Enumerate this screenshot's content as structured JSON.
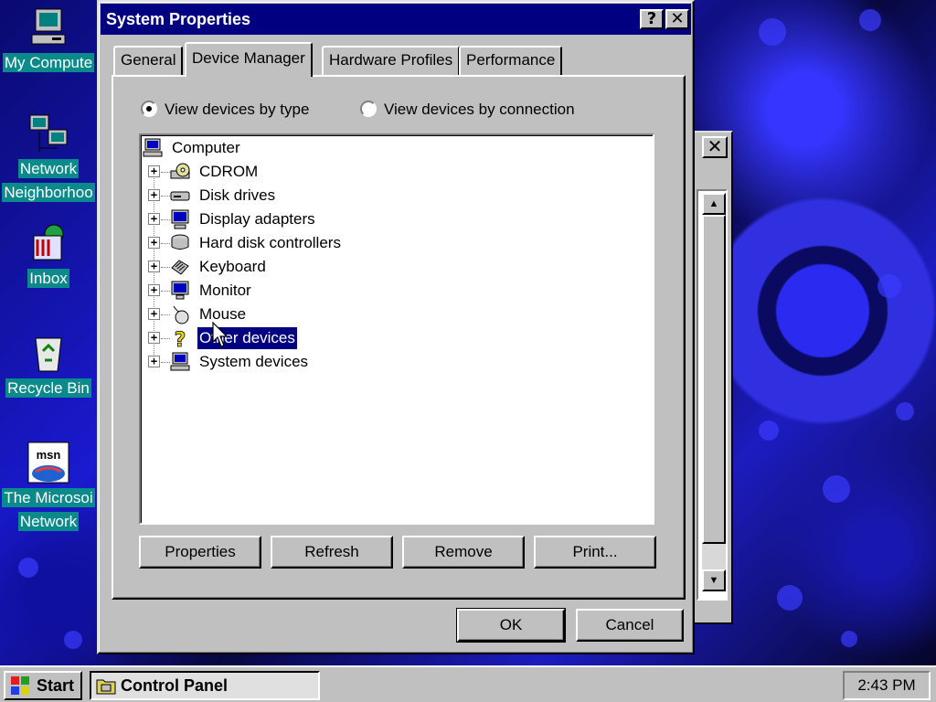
{
  "desktop": {
    "icons": [
      {
        "label": "My Compute",
        "icon": "my-computer-icon"
      },
      {
        "label": "Network",
        "label2": "Neighborhoo",
        "icon": "network-neighborhood-icon"
      },
      {
        "label": "Inbox",
        "icon": "inbox-icon"
      },
      {
        "label": "Recycle Bin",
        "icon": "recycle-bin-icon"
      },
      {
        "label": "The Microsoi",
        "label2": "Network",
        "icon": "msn-icon"
      }
    ],
    "msn_logo_text": "msn"
  },
  "dialog": {
    "title": "System Properties",
    "help_button": "?",
    "close_button": "✕",
    "tabs": [
      {
        "label": "General",
        "active": false
      },
      {
        "label": "Device Manager",
        "active": true
      },
      {
        "label": "Hardware Profiles",
        "active": false
      },
      {
        "label": "Performance",
        "active": false
      }
    ],
    "view_options": [
      {
        "label": "View devices by type",
        "checked": true
      },
      {
        "label": "View devices by connection",
        "checked": false
      }
    ],
    "tree": {
      "root": {
        "label": "Computer",
        "icon": "computer-icon"
      },
      "expander": "+",
      "items": [
        {
          "label": "CDROM",
          "icon": "cdrom-icon"
        },
        {
          "label": "Disk drives",
          "icon": "disk-drive-icon"
        },
        {
          "label": "Display adapters",
          "icon": "display-adapter-icon"
        },
        {
          "label": "Hard disk controllers",
          "icon": "hard-disk-controller-icon"
        },
        {
          "label": "Keyboard",
          "icon": "keyboard-icon"
        },
        {
          "label": "Monitor",
          "icon": "monitor-icon"
        },
        {
          "label": "Mouse",
          "icon": "mouse-icon"
        },
        {
          "label": "Other devices",
          "icon": "question-mark-icon",
          "selected": true
        },
        {
          "label": "System devices",
          "icon": "system-devices-icon"
        }
      ]
    },
    "buttons": {
      "properties": "Properties",
      "refresh": "Refresh",
      "remove": "Remove",
      "print": "Print...",
      "ok": "OK",
      "cancel": "Cancel"
    }
  },
  "background_window": {
    "close_button": "✕"
  },
  "taskbar": {
    "start_label": "Start",
    "task_label": "Control Panel",
    "clock": "2:43 PM"
  },
  "colors": {
    "title_bar": "#000080",
    "face": "#c0c0c0",
    "desktop_label_bg": "#0a8a8a"
  }
}
